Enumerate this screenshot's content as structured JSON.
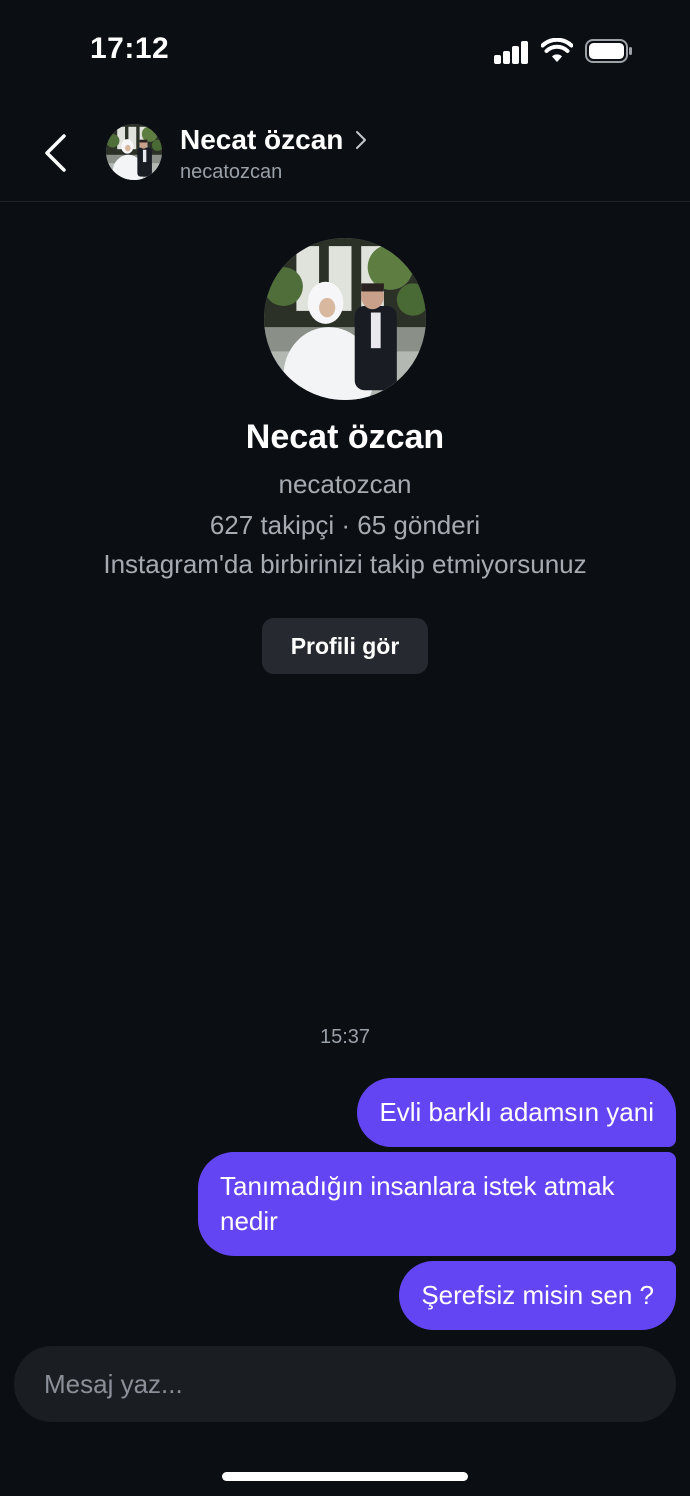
{
  "status_bar": {
    "time": "17:12"
  },
  "header": {
    "name": "Necat özcan",
    "username": "necatozcan"
  },
  "profile": {
    "name": "Necat özcan",
    "username": "necatozcan",
    "stats": "627 takipçi · 65 gönderi",
    "follow_status": "Instagram'da birbirinizi takip etmiyorsunuz",
    "view_profile_label": "Profili gör"
  },
  "conversation": {
    "timestamp": "15:37",
    "messages": [
      {
        "text": "Evli barklı adamsın yani",
        "sender": "me"
      },
      {
        "text": "Tanımadığın insanlara istek atmak nedir",
        "sender": "me"
      },
      {
        "text": "Şerefsiz misin sen ?",
        "sender": "me"
      }
    ]
  },
  "composer": {
    "placeholder": "Mesaj yaz..."
  },
  "colors": {
    "background": "#0b0f14",
    "bubble": "#6445f4",
    "button": "#262a30",
    "composer": "#1a1d22",
    "muted_text": "#a6abb2"
  }
}
